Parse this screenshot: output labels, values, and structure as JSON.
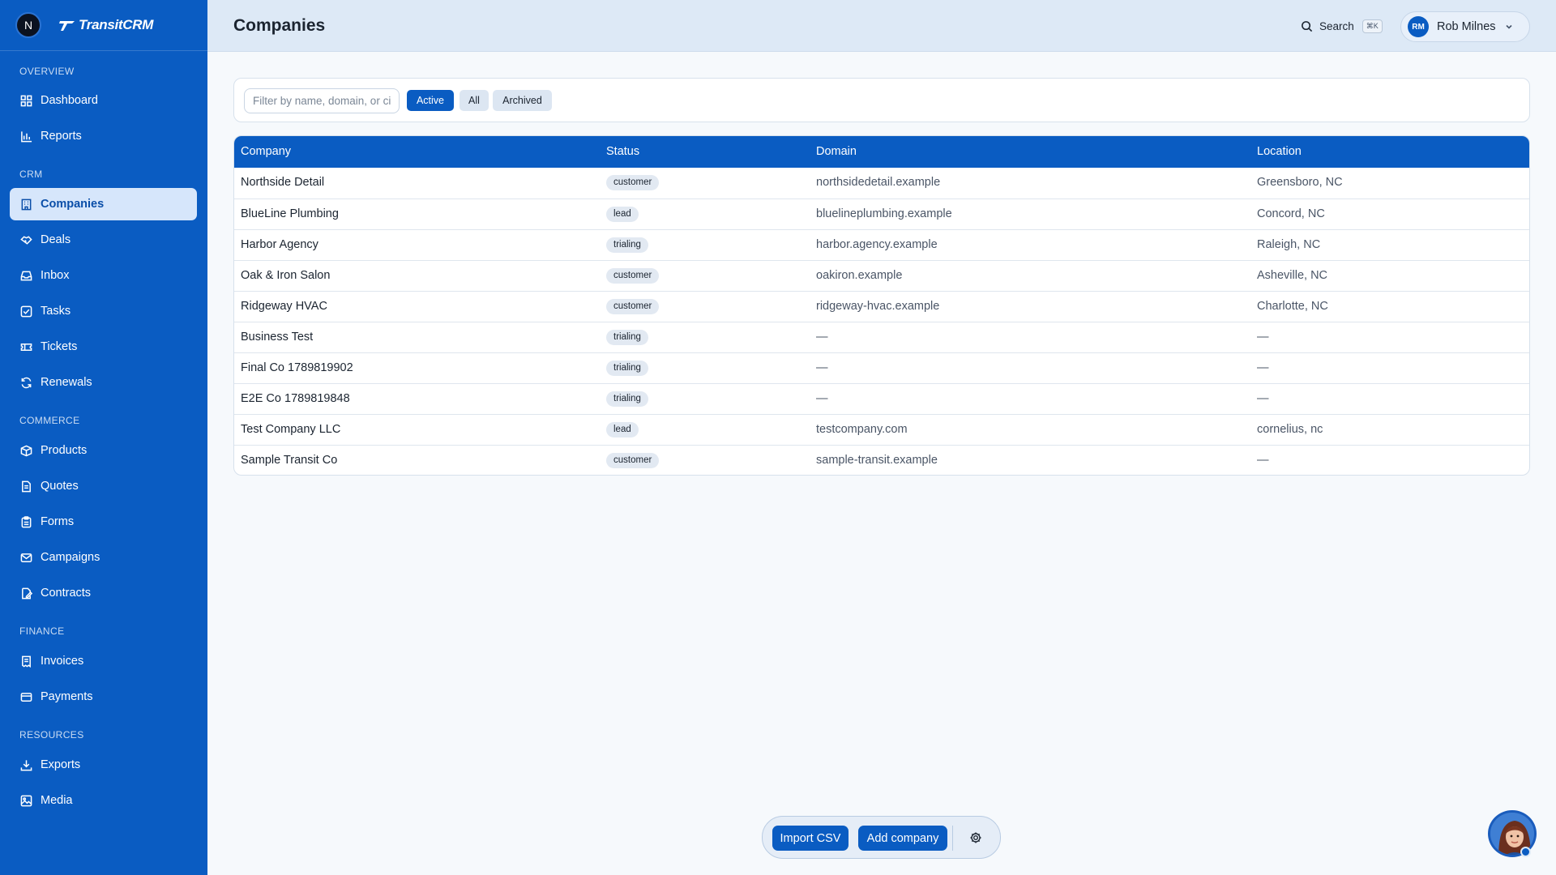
{
  "brand": {
    "workspace_initial": "N",
    "logo_text": "TransitCRM"
  },
  "sidebar": {
    "sections": [
      {
        "label": "OVERVIEW"
      },
      {
        "label": "CRM"
      },
      {
        "label": "COMMERCE"
      },
      {
        "label": "FINANCE"
      },
      {
        "label": "RESOURCES"
      }
    ],
    "items": [
      {
        "label": "Dashboard",
        "icon": "dashboard-icon"
      },
      {
        "label": "Reports",
        "icon": "bar-chart-icon"
      },
      {
        "label": "Companies",
        "icon": "building-icon",
        "active": true
      },
      {
        "label": "Deals",
        "icon": "handshake-icon"
      },
      {
        "label": "Inbox",
        "icon": "inbox-icon"
      },
      {
        "label": "Tasks",
        "icon": "checklist-icon"
      },
      {
        "label": "Tickets",
        "icon": "ticket-icon"
      },
      {
        "label": "Renewals",
        "icon": "refresh-icon"
      },
      {
        "label": "Products",
        "icon": "package-icon"
      },
      {
        "label": "Quotes",
        "icon": "document-icon"
      },
      {
        "label": "Forms",
        "icon": "clipboard-icon"
      },
      {
        "label": "Campaigns",
        "icon": "mail-icon"
      },
      {
        "label": "Contracts",
        "icon": "contract-icon"
      },
      {
        "label": "Invoices",
        "icon": "receipt-icon"
      },
      {
        "label": "Payments",
        "icon": "credit-card-icon"
      },
      {
        "label": "Exports",
        "icon": "download-icon"
      },
      {
        "label": "Media",
        "icon": "image-icon"
      }
    ]
  },
  "header": {
    "title": "Companies",
    "search_label": "Search",
    "search_shortcut": "⌘K",
    "user_initials": "RM",
    "user_name": "Rob Milnes"
  },
  "filters": {
    "placeholder": "Filter by name, domain, or city",
    "segments": [
      {
        "label": "Active",
        "selected": true
      },
      {
        "label": "All",
        "selected": false
      },
      {
        "label": "Archived",
        "selected": false
      }
    ]
  },
  "table": {
    "columns": [
      "Company",
      "Status",
      "Domain",
      "Location"
    ],
    "rows": [
      {
        "company": "Northside Detail",
        "status": "customer",
        "domain": "northsidedetail.example",
        "location": "Greensboro, NC"
      },
      {
        "company": "BlueLine Plumbing",
        "status": "lead",
        "domain": "bluelineplumbing.example",
        "location": "Concord, NC"
      },
      {
        "company": "Harbor Agency",
        "status": "trialing",
        "domain": "harbor.agency.example",
        "location": "Raleigh, NC"
      },
      {
        "company": "Oak & Iron Salon",
        "status": "customer",
        "domain": "oakiron.example",
        "location": "Asheville, NC"
      },
      {
        "company": "Ridgeway HVAC",
        "status": "customer",
        "domain": "ridgeway-hvac.example",
        "location": "Charlotte, NC"
      },
      {
        "company": "Business Test",
        "status": "trialing",
        "domain": "—",
        "location": "—"
      },
      {
        "company": "Final Co 1789819902",
        "status": "trialing",
        "domain": "—",
        "location": "—"
      },
      {
        "company": "E2E Co 1789819848",
        "status": "trialing",
        "domain": "—",
        "location": "—"
      },
      {
        "company": "Test Company LLC",
        "status": "lead",
        "domain": "testcompany.com",
        "location": "cornelius, nc"
      },
      {
        "company": "Sample Transit Co",
        "status": "customer",
        "domain": "sample-transit.example",
        "location": "—"
      }
    ]
  },
  "actions": {
    "import_label": "Import CSV",
    "add_label": "Add company"
  },
  "colors": {
    "brand": "#0a5cc2",
    "sidebar_active_bg": "#d6e6fb",
    "page_bg": "#f6f9fc"
  }
}
